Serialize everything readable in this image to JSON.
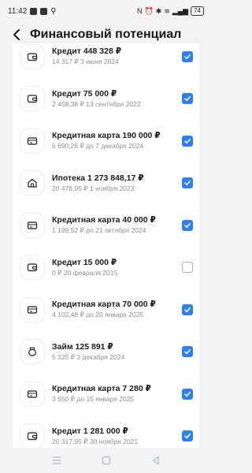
{
  "status": {
    "time": "11:42",
    "battery": "74"
  },
  "header": {
    "title": "Финансовый потенциал"
  },
  "items": [
    {
      "icon": "wallet-icon",
      "title": "Кредит 448 328 ₽",
      "sub": "14 317 ₽ 3 июня 2024",
      "checked": true
    },
    {
      "icon": "wallet-icon",
      "title": "Кредит 75 000 ₽",
      "sub": "2 458,38 ₽ 13 сентября 2022",
      "checked": true
    },
    {
      "icon": "credit-card-icon",
      "title": "Кредитная карта 190 000 ₽",
      "sub": "6 690,26 ₽ до 7 декабря 2024",
      "checked": true
    },
    {
      "icon": "house-icon",
      "title": "Ипотека 1 273 848,17 ₽",
      "sub": "20 478,05 ₽ 1 ноября 2023",
      "checked": true
    },
    {
      "icon": "credit-card-icon",
      "title": "Кредитная карта 40 000 ₽",
      "sub": "1 199,52 ₽ до 21 октября 2024",
      "checked": true
    },
    {
      "icon": "wallet-icon",
      "title": "Кредит 15 000 ₽",
      "sub": "0 ₽ 20 февраля 2015",
      "checked": false
    },
    {
      "icon": "credit-card-icon",
      "title": "Кредитная карта 70 000 ₽",
      "sub": "4 102,48 ₽ до 20 января 2025",
      "checked": true
    },
    {
      "icon": "money-bag-icon",
      "title": "Займ 125 891 ₽",
      "sub": "5 325 ₽ 3 декабря 2024",
      "checked": true
    },
    {
      "icon": "credit-card-icon",
      "title": "Кредитная карта 7 280 ₽",
      "sub": "3 650 ₽ до 15 января 2025",
      "checked": true
    },
    {
      "icon": "wallet-icon",
      "title": "Кредит 1 281 000 ₽",
      "sub": "20 317,95 ₽ 30 ноября 2021",
      "checked": true
    }
  ],
  "colors": {
    "accent": "#2f80ed",
    "background": "#f2f3f5"
  }
}
